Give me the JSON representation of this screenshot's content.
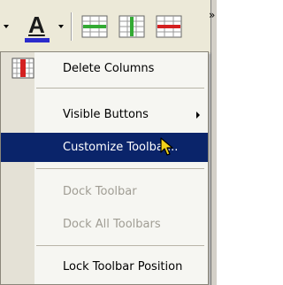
{
  "toolbar": {
    "font_color_letter": "A",
    "font_color_bar_color": "#2b2bcc",
    "buttons": [
      {
        "name": "insert-row-icon",
        "accent": "#33aa33"
      },
      {
        "name": "insert-column-icon",
        "accent": "#33aa33"
      },
      {
        "name": "delete-row-icon",
        "accent": "#d42020"
      }
    ]
  },
  "menu": {
    "highlight_color": "#0a246a",
    "items": [
      {
        "label": "Delete Columns",
        "icon": "delete-columns-icon",
        "enabled": true
      },
      {
        "label": "Visible Buttons",
        "submenu": true,
        "enabled": true
      },
      {
        "label": "Customize Toolbar...",
        "highlighted": true,
        "enabled": true
      },
      {
        "label": "Dock Toolbar",
        "enabled": false
      },
      {
        "label": "Dock All Toolbars",
        "enabled": false
      },
      {
        "label": "Lock Toolbar Position",
        "enabled": true
      }
    ]
  }
}
